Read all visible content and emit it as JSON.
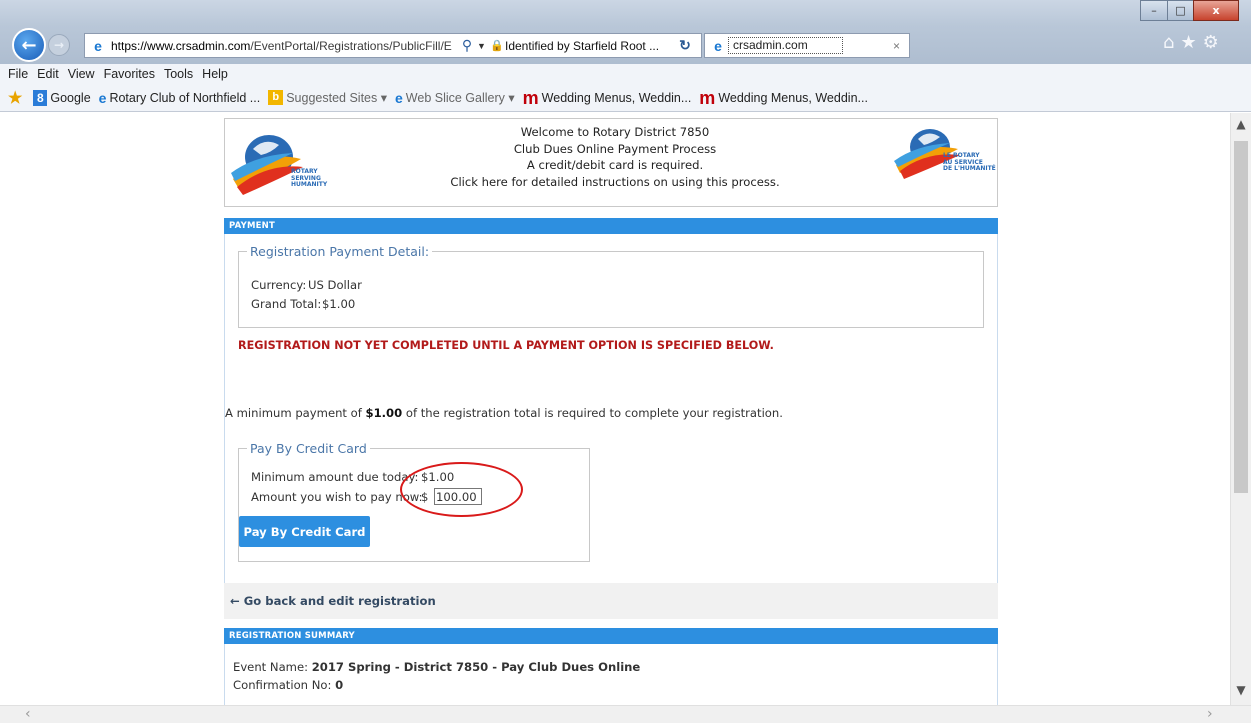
{
  "browser": {
    "address_url_prefix": "https://",
    "address_url_domain": "www.crsadmin.com",
    "address_url_path": "/EventPortal/Registrations/PublicFill/E",
    "certificate": "Identified by Starfield Root ...",
    "tab_title": "crsadmin.com",
    "tab_close": "×",
    "window_controls": {
      "minimize": "–",
      "maximize": "□",
      "close": "x"
    },
    "menu": [
      "File",
      "Edit",
      "View",
      "Favorites",
      "Tools",
      "Help"
    ],
    "favorites": [
      {
        "icon": "google-8-icon",
        "label": "Google"
      },
      {
        "icon": "ie-page-icon",
        "label": "Rotary Club of Northfield ..."
      },
      {
        "icon": "bing-icon",
        "label": "Suggested Sites ▾"
      },
      {
        "icon": "ie-page-icon",
        "label": "Web Slice Gallery ▾"
      },
      {
        "icon": "m-logo-icon",
        "label": "Wedding Menus, Weddin..."
      },
      {
        "icon": "m-logo-icon",
        "label": "Wedding Menus, Weddin..."
      }
    ]
  },
  "header": {
    "line1": "Welcome to Rotary District 7850",
    "line2": "Club Dues Online Payment Process",
    "line3": "A credit/debit card is required.",
    "line4": "Click here for detailed instructions on using this process.",
    "logo_left_text": "ROTARY\nSERVING\nHUMANITY",
    "logo_right_text": "LE ROTARY\nAU SERVICE\nDE L'HUMANITÉ"
  },
  "payment": {
    "section_title": "PAYMENT",
    "detail_legend": "Registration Payment Detail:",
    "currency_label": "Currency:",
    "currency_value": "US Dollar",
    "total_label": "Grand Total:",
    "total_value": "$1.00",
    "warning": "REGISTRATION NOT YET COMPLETED UNTIL A PAYMENT OPTION IS SPECIFIED BELOW.",
    "min_text_before": "A minimum payment of ",
    "min_text_amount": "$1.00",
    "min_text_after": " of the registration total is required to complete your registration.",
    "cc_legend": "Pay By Credit Card",
    "min_due_label": "Minimum amount due today:",
    "min_due_value": "$1.00",
    "wish_label": "Amount you wish to pay now:",
    "wish_currency": "$",
    "wish_value": "100.00",
    "pay_button": "Pay By Credit Card",
    "back_link": "← Go back and edit registration"
  },
  "summary": {
    "section_title": "REGISTRATION SUMMARY",
    "event_label": "Event Name: ",
    "event_value": "2017 Spring - District 7850 - Pay Club Dues Online",
    "confirm_label": "Confirmation No: ",
    "confirm_value": "0"
  },
  "colors": {
    "accent": "#2d8fe0",
    "warning": "#b21a1a",
    "annotation_circle": "#d91a1a"
  }
}
